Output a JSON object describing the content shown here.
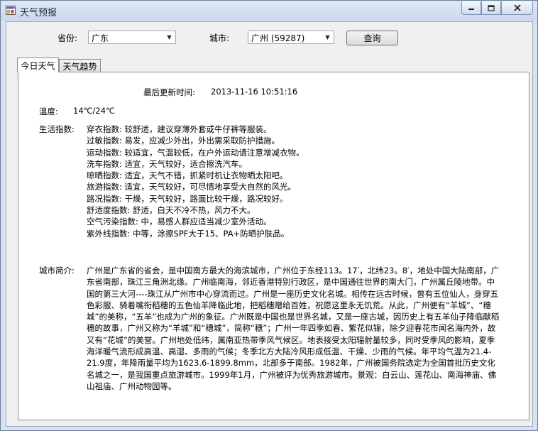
{
  "window": {
    "title": "天气预报"
  },
  "form": {
    "province_label": "省份:",
    "province_value": "广东",
    "city_label": "城市:",
    "city_value": "广州 (59287)",
    "query_button": "查询"
  },
  "tabs": [
    {
      "label": "今日天气",
      "active": true
    },
    {
      "label": "天气趋势",
      "active": false
    }
  ],
  "today": {
    "update_label": "最后更新时间:",
    "update_time": "2013-11-16 10:51:16",
    "temp_label": "温度:",
    "temp_value": "14℃/24℃",
    "life_label": "生活指数:",
    "life_items": [
      "穿衣指数: 较舒适，建议穿薄外套或牛仔裤等服装。",
      "过敏指数: 易发，应减少外出，外出需采取防护措施。",
      "运动指数: 较适宜，气温较低，在户外运动请注意增减衣物。",
      "洗车指数: 适宜，天气较好，适合擦洗汽车。",
      "晾晒指数: 适宜，天气不错，抓紧时机让衣物晒太阳吧。",
      "旅游指数: 适宜，天气较好，可尽情地享受大自然的风光。",
      "路况指数: 干燥，天气较好，路面比较干燥，路况较好。",
      "舒适度指数: 舒适，白天不冷不热，风力不大。",
      "空气污染指数: 中，易感人群应适当减少室外活动。",
      "紫外线指数: 中等，涂擦SPF大于15、PA+防晒护肤品。"
    ],
    "intro_label": "城市简介:",
    "intro_text": "广州是广东省的省会，是中国南方最大的海滨城市，广州位于东经113。17′，北纬23。8′，地处中国大陆南部，广东省南部，珠江三角洲北缘。广州临南海，邻近香港特别行政区，是中国通往世界的南大门，广州属丘陵地带。中国的第三大河----珠江从广州市中心穿流而过。广州是一座历史文化名城。相传在远古时候，曾有五位仙人，身穿五色彩服、骑着嘴衔稻穗的五色仙羊降临此地，把稻穗赠给百姓，祝愿这里永无饥荒。从此，广州便有“羊城”、“穗城”的美称，“五羊”也成为广州的象征。广州既是中国也是世界名城，又是一座古城，因历史上有五羊仙子降临献稻穗的故事，广州又称为“羊城”和“穗城”，简称“穗”；广州一年四季如春、繁花似锦，除夕迎春花市闻名海内外，故又有“花城”的美誉。广州地处低纬，属南亚热带季风气候区。地表接受太阳辐射量较多，同时受季风的影响，夏季海洋暖气流形成高温、高湿、多雨的气候；冬季北方大陆冷风形成低温、干燥、少雨的气候。年平均气温为21.4-21.9度，年降雨量平均为1623.6-1899.8mm，北部多于南部。1982年，广州被国务院选定为全国首批历史文化名城之一，是我国重点旅游城市。1999年1月，广州被评为优秀旅游城市。景观：白云山、莲花山、南海神庙、佛山祖庙、广州动物园等。"
  }
}
